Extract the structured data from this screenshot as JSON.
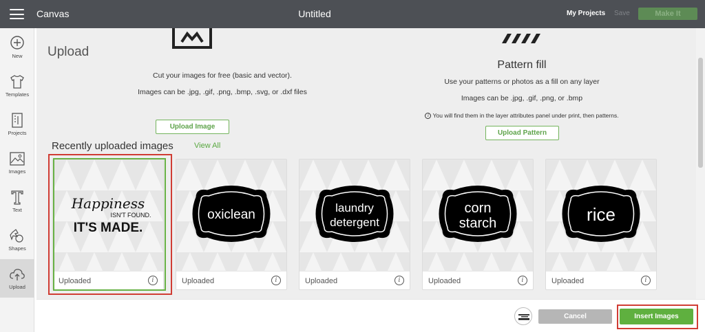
{
  "topbar": {
    "app_name": "Canvas",
    "document_title": "Untitled",
    "my_projects_label": "My Projects",
    "save_label": "Save",
    "make_it_label": "Make It"
  },
  "sidebar": {
    "items": [
      {
        "label": "New",
        "icon": "plus-circle-icon"
      },
      {
        "label": "Templates",
        "icon": "shirt-icon"
      },
      {
        "label": "Projects",
        "icon": "projects-book-icon"
      },
      {
        "label": "Images",
        "icon": "image-icon"
      },
      {
        "label": "Text",
        "icon": "text-T-icon"
      },
      {
        "label": "Shapes",
        "icon": "shapes-icon"
      },
      {
        "label": "Upload",
        "icon": "cloud-upload-icon",
        "active": true
      }
    ]
  },
  "upload_section": {
    "heading": "Upload",
    "line1": "Cut your images for free (basic and vector).",
    "line2": "Images can be .jpg, .gif, .png, .bmp, .svg, or .dxf files",
    "button_label": "Upload Image"
  },
  "pattern_section": {
    "heading": "Pattern fill",
    "line1": "Use your patterns or photos as a fill on any layer",
    "line2": "Images can be .jpg, .gif, .png, or .bmp",
    "note": "You will find them in the layer attributes panel under print, then patterns.",
    "note_icon": "info-circle-icon",
    "button_label": "Upload Pattern"
  },
  "recent": {
    "heading": "Recently uploaded images",
    "view_all_label": "View All",
    "items": [
      {
        "label": "Uploaded",
        "art": {
          "line1": "Happiness",
          "line2": "ISN'T FOUND.",
          "line3": "IT'S MADE."
        },
        "selected": true
      },
      {
        "label": "Uploaded",
        "art": {
          "line1": "oxiclean"
        }
      },
      {
        "label": "Uploaded",
        "art": {
          "line1": "laundry",
          "line2": "detergent"
        }
      },
      {
        "label": "Uploaded",
        "art": {
          "line1": "corn",
          "line2": "starch"
        }
      },
      {
        "label": "Uploaded",
        "art": {
          "line1": "rice"
        }
      }
    ]
  },
  "footer": {
    "cancel_label": "Cancel",
    "insert_label": "Insert Images"
  },
  "colors": {
    "accent_green": "#5fb03f",
    "topbar": "#4d5055",
    "highlight_red": "#d03c33"
  }
}
